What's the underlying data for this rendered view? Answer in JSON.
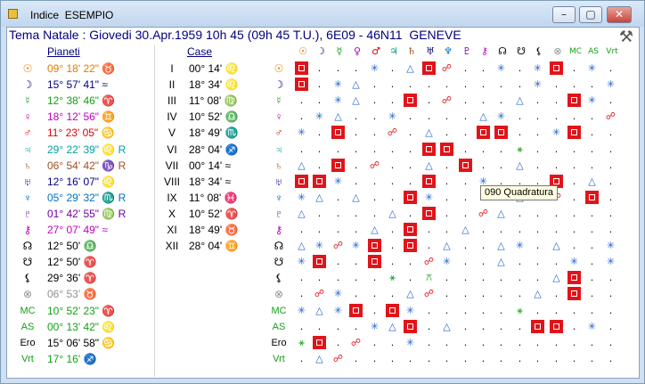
{
  "window": {
    "title": "Indice  ESEMPIO",
    "minimize": "–",
    "maximize": "▢",
    "close": "✕"
  },
  "header": "Tema Natale : Giovedi 30.Apr.1959 10h 45 (09h 45 T.U.), 6E09 - 46N11  GENEVE",
  "headings": {
    "planets": "Pianeti",
    "houses": "Case"
  },
  "tooltip": "090 Quadratura",
  "rows": [
    {
      "sym": "☉",
      "col": "#e07a00",
      "pos": "09° 18' 22\" ♉",
      "house": "I",
      "hpos": "00° 14' ♌"
    },
    {
      "sym": "☽",
      "col": "#00007f",
      "pos": "15° 57' 41\" ≈",
      "house": "II",
      "hpos": "18° 34' ♌"
    },
    {
      "sym": "☿",
      "col": "#14a014",
      "pos": "12° 38' 46\" ♈",
      "house": "III",
      "hpos": "11° 08' ♍"
    },
    {
      "sym": "♀",
      "col": "#c000c0",
      "pos": "18° 12' 56\" ♊",
      "house": "IV",
      "hpos": "10° 52' ♎"
    },
    {
      "sym": "♂",
      "col": "#e00000",
      "pos": "11° 23' 05\" ♋",
      "house": "V",
      "hpos": "18° 49' ♏"
    },
    {
      "sym": "♃",
      "col": "#00a0a0",
      "pos": "29° 22' 39\" ♌ R",
      "house": "VI",
      "hpos": "28° 04' ♐"
    },
    {
      "sym": "♄",
      "col": "#a05020",
      "pos": "06° 54' 42\" ♑ R",
      "house": "VII",
      "hpos": "00° 14' ≈"
    },
    {
      "sym": "♅",
      "col": "#00007f",
      "pos": "12° 16' 07\" ♌",
      "house": "VIII",
      "hpos": "18° 34' ≈"
    },
    {
      "sym": "♆",
      "col": "#0070c0",
      "pos": "05° 29' 32\" ♏ R",
      "house": "IX",
      "hpos": "11° 08' ♓"
    },
    {
      "sym": "♇",
      "col": "#7000a0",
      "pos": "01° 42' 55\" ♍ R",
      "house": "X",
      "hpos": "10° 52' ♈"
    },
    {
      "sym": "⚷",
      "col": "#c000c0",
      "pos": "27° 07' 49\" ≈",
      "house": "XI",
      "hpos": "18° 49' ♉"
    },
    {
      "sym": "☊",
      "col": "#000000",
      "pos": "12° 50' ♎",
      "house": "XII",
      "hpos": "28° 04' ♊"
    },
    {
      "sym": "☋",
      "col": "#000000",
      "pos": "12° 50' ♈",
      "house": "",
      "hpos": ""
    },
    {
      "sym": "⚸",
      "col": "#000000",
      "pos": "29° 36' ♈",
      "house": "",
      "hpos": ""
    },
    {
      "sym": "⊗",
      "col": "#909090",
      "pos": "06° 53' ♉",
      "house": "",
      "hpos": ""
    },
    {
      "sym": "MC",
      "col": "#14a014",
      "pos": "10° 52' 23\" ♈",
      "house": "",
      "hpos": ""
    },
    {
      "sym": "AS",
      "col": "#14a014",
      "pos": "00° 13' 42\" ♌",
      "house": "",
      "hpos": ""
    },
    {
      "sym": "Ero",
      "col": "#000000",
      "pos": "15° 06' 58\" ♋",
      "house": "",
      "hpos": ""
    },
    {
      "sym": "Vrt",
      "col": "#14a014",
      "pos": "17° 16' ♐",
      "house": "",
      "hpos": ""
    }
  ],
  "grid": {
    "cols": [
      "☉",
      "☽",
      "☿",
      "♀",
      "♂",
      "♃",
      "♄",
      "♅",
      "♆",
      "♇",
      "⚷",
      "☊",
      "☋",
      "⚸",
      "⊗",
      "MC",
      "AS",
      "Vrt"
    ],
    "colColors": [
      "#e07a00",
      "#00007f",
      "#14a014",
      "#c000c0",
      "#e00000",
      "#00a0a0",
      "#a05020",
      "#00007f",
      "#0070c0",
      "#7000a0",
      "#c000c0",
      "#000000",
      "#000000",
      "#000000",
      "#909090",
      "#14a014",
      "#14a014",
      "#14a014"
    ],
    "rows": [
      "Q . . . * . T Q ☍ . . * . * Q . * .",
      "Q . * T . . . . . . . . . * . . . *",
      ". . * T . . Q . ☍ . . . T . . Q * .",
      ". * T . . * . . . . T * . . . . . ☍",
      "* . Q . . ☍ . T . . Q Q . . * Q . .",
      ". . . . . . . Q Q . . . ⚹ . . . . .",
      "T . Q . ☍ . . T . Q . . T . . . . .",
      "Q Q * . . . . Q . . * . . . Q . T .",
      "* T . T . . Q * . . . * T ☍ ☍ . Q .",
      "T . . . . T . Q . . ☍ T . . . . . .",
      ". . . . T . Q . . T . . . . . . . .",
      "T * ☍ * Q . Q . T . . T * . T . . *",
      "* Q . . Q . . ☍ * . . T . . . * . *",
      ". . . . . ⚹ . ⚻ . . . . . . T Q . .",
      ". ☍ * . . . T ☍ . . . . . T . Q . .",
      "* T * Q . Q * . . . . . ⚹ . . . . .",
      ". . . . * T Q . T . . . . Q Q . * .",
      "⚹ Q . ☍ . . * . . . . . . . . . . .",
      ". T ☍ . . . . . . . . . . . . . . ."
    ],
    "highlight": [
      4,
      12
    ]
  }
}
